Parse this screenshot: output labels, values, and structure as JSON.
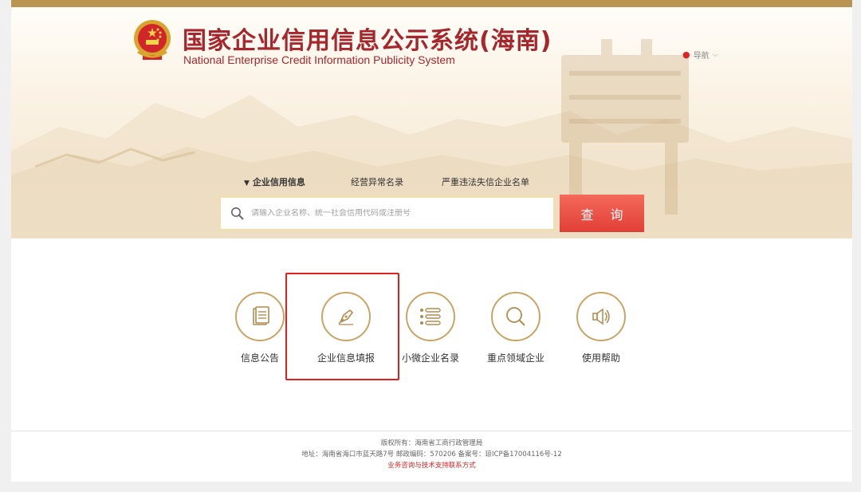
{
  "header": {
    "title_cn": "国家企业信用信息公示系统(海南)",
    "title_en": "National Enterprise Credit Information Publicity System",
    "nav_label": "导航",
    "emblem_icon": "national-emblem-icon"
  },
  "search": {
    "tabs": [
      {
        "label": "企业信用信息",
        "active": true
      },
      {
        "label": "经营异常名录",
        "active": false
      },
      {
        "label": "严重违法失信企业名单",
        "active": false
      }
    ],
    "placeholder": "请输入企业名称、统一社会信用代码或注册号",
    "button_label": "查 询"
  },
  "features": [
    {
      "label": "信息公告",
      "icon": "document-icon"
    },
    {
      "label": "企业信息填报",
      "icon": "pen-icon"
    },
    {
      "label": "小微企业名录",
      "icon": "list-icon"
    },
    {
      "label": "重点领域企业",
      "icon": "magnifier-icon"
    },
    {
      "label": "使用帮助",
      "icon": "speaker-icon"
    }
  ],
  "footer": {
    "copyright": "版权所有：海南省工商行政管理局",
    "address": "地址：海南省海口市蓝天路7号 邮政编码：570206 备案号：琼ICP备17004116号-12",
    "support": "业务咨询与技术支持联系方式"
  },
  "colors": {
    "brand_red": "#a5272b",
    "gold": "#caa464",
    "button_red": "#e23e36",
    "highlight": "#e0201e"
  }
}
